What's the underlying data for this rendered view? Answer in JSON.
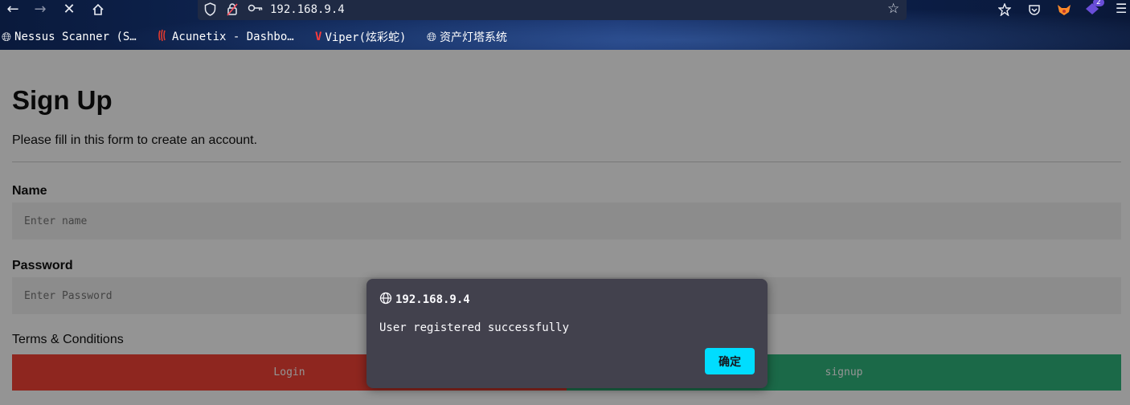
{
  "browser": {
    "url": "192.168.9.4",
    "bookmarks": [
      {
        "label": "Nessus Scanner (S…",
        "icon": "globe-icon"
      },
      {
        "label": "Acunetix - Dashbo…",
        "icon": "acunetix-icon"
      },
      {
        "label": "Viper(炫彩蛇)",
        "icon": "viper-icon"
      },
      {
        "label": "资产灯塔系统",
        "icon": "globe-icon"
      }
    ],
    "notification_count": "2"
  },
  "form": {
    "title": "Sign Up",
    "subtitle": "Please fill in this form to create an account.",
    "name_label": "Name",
    "name_placeholder": "Enter name",
    "password_label": "Password",
    "password_placeholder": "Enter Password",
    "terms_text": "Terms & Conditions",
    "login_label": "Login",
    "signup_label": "signup"
  },
  "dialog": {
    "origin": "192.168.9.4",
    "message": "User registered successfully",
    "ok_label": "确定"
  },
  "colors": {
    "login_button": "#f44336",
    "signup_button": "#2fb67c",
    "dialog_bg": "#42414d",
    "dialog_ok": "#00ddff"
  }
}
